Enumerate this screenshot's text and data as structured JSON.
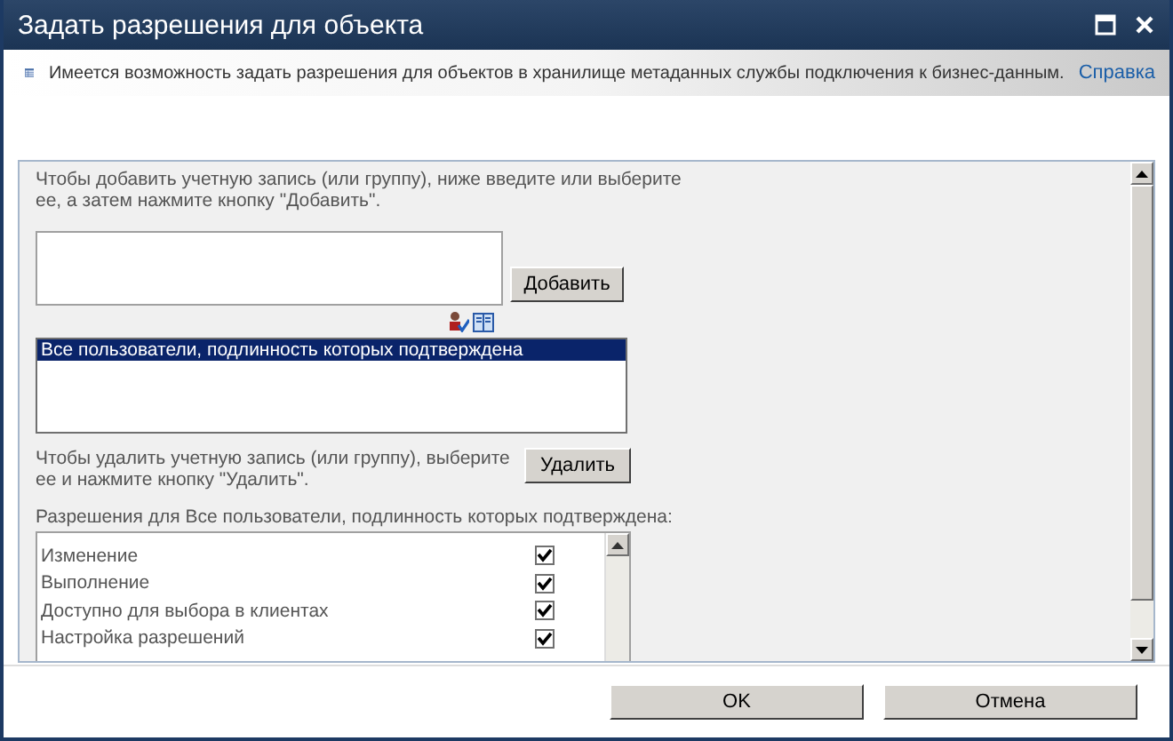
{
  "window": {
    "title": "Задать разрешения для объекта"
  },
  "info_bar": {
    "text": "Имеется возможность задать разрешения для объектов в хранилище метаданных службы подключения к бизнес-данным.",
    "help_link": "Справка"
  },
  "add_section": {
    "instructions": "Чтобы добавить учетную запись (или группу), ниже введите или выберите ее, а затем нажмите кнопку \"Добавить\".",
    "add_button": "Добавить"
  },
  "accounts": [
    {
      "name": "Все пользователи, подлинность которых подтверждена",
      "selected": true
    }
  ],
  "remove_section": {
    "instructions": "Чтобы удалить учетную запись (или группу), выберите ее и нажмите кнопку \"Удалить\".",
    "remove_button": "Удалить"
  },
  "permissions": {
    "label": "Разрешения для Все пользователи, подлинность которых подтверждена:",
    "items": [
      {
        "name": "Изменение",
        "checked": true
      },
      {
        "name": "Выполнение",
        "checked": true
      },
      {
        "name": "Доступно для выбора в клиентах",
        "checked": true
      },
      {
        "name": "Настройка разрешений",
        "checked": true
      }
    ]
  },
  "buttons": [
    {
      "label": "OK"
    },
    {
      "label": "Отмена"
    }
  ]
}
